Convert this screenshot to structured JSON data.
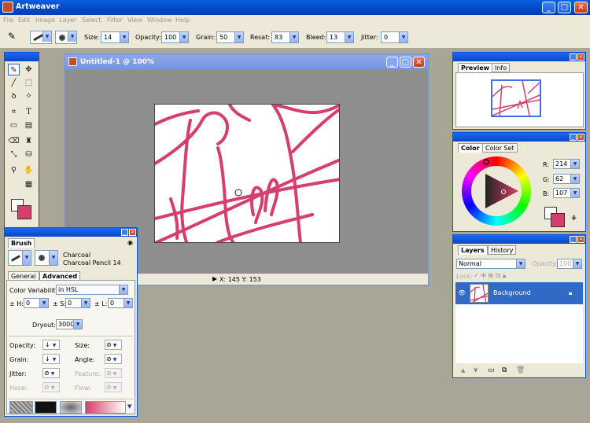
{
  "app": {
    "title": "Artweaver"
  },
  "menu": [
    "File",
    "Edit",
    "Image",
    "Layer",
    "Select",
    "Filter",
    "View",
    "Window",
    "Help"
  ],
  "options": {
    "size_label": "Size:",
    "size": "14",
    "opacity_label": "Opacity:",
    "opacity": "100",
    "grain_label": "Grain:",
    "grain": "50",
    "resat_label": "Resat:",
    "resat": "83",
    "bleed_label": "Bleed:",
    "bleed": "13",
    "jitter_label": "Jitter:",
    "jitter": "0"
  },
  "document": {
    "title": "Untitled-1 @ 100%",
    "status": "X: 145  Y: 153"
  },
  "preview": {
    "tabs": [
      "Preview",
      "Info"
    ]
  },
  "color": {
    "tabs": [
      "Color",
      "Color Set"
    ],
    "r_label": "R:",
    "r": "214",
    "g_label": "G:",
    "g": "62",
    "b_label": "B:",
    "b": "107",
    "foreground": "#d63e6b",
    "background": "#ffffff"
  },
  "layers": {
    "tabs": [
      "Layers",
      "History"
    ],
    "mode": "Normal",
    "opacity_label": "Opacity:",
    "opacity": "100",
    "lock_label": "Lock:",
    "layer_name": "Background"
  },
  "brush": {
    "tab": "Brush",
    "category": "Charcoal",
    "variant": "Charcoal Pencil 14",
    "subtabs": [
      "General",
      "Advanced"
    ],
    "color_variability_label": "Color Variability:",
    "color_variability": "in HSL",
    "h_label": "± H:",
    "h": "0",
    "s_label": "± S:",
    "s": "0",
    "l_label": "± L:",
    "l": "0",
    "dryout_label": "Dryout:",
    "dryout": "3000",
    "opacity_label": "Opacity:",
    "size_label": "Size:",
    "grain_label": "Grain:",
    "angle_label": "Angle:",
    "jitter_label": "Jitter:",
    "feature_label": "Feature:",
    "hose_label": "Hose:",
    "flow_label": "Flow:"
  }
}
